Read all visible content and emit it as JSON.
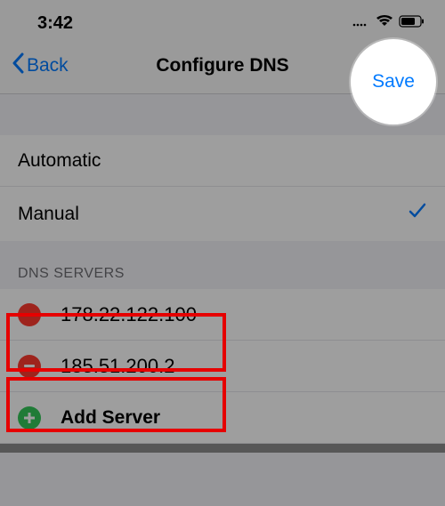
{
  "status": {
    "time": "3:42"
  },
  "nav": {
    "back_label": "Back",
    "title": "Configure DNS",
    "save_label": "Save"
  },
  "config_mode": {
    "automatic_label": "Automatic",
    "manual_label": "Manual"
  },
  "dns": {
    "section_title": "DNS SERVERS",
    "servers": [
      "178.22.122.100",
      "185.51.200.2"
    ],
    "add_label": "Add Server"
  }
}
